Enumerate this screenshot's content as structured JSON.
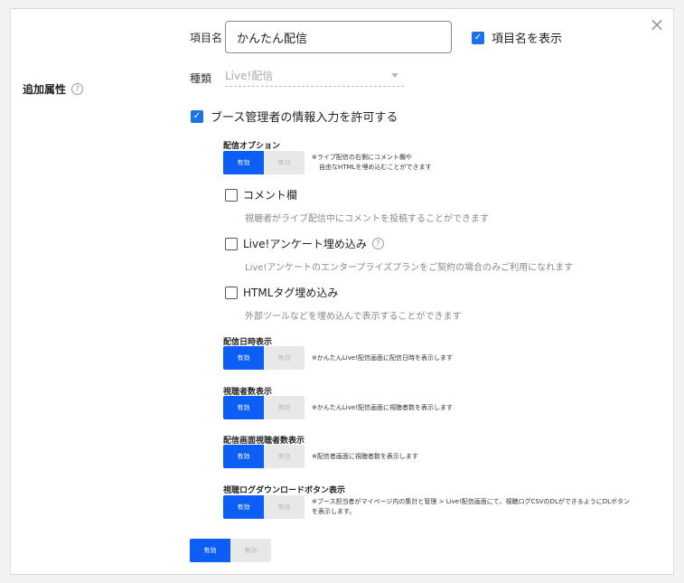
{
  "section": {
    "label": "追加属性",
    "help_icon": "question-circle-icon"
  },
  "item_name": {
    "label": "項目名",
    "value": "かんたん配信"
  },
  "show_item_name": {
    "label": "項目名を表示",
    "checked": true
  },
  "type": {
    "label": "種類",
    "value": "Live!配信"
  },
  "allow_booth": {
    "label": "ブース管理者の情報入力を許可する",
    "checked": true
  },
  "delivery_option": {
    "title": "配信オプション",
    "on_label": "有効",
    "off_label": "無効",
    "note_line1": "※ライブ配信の右側にコメント欄や",
    "note_line2": "自由なHTMLを埋め込むことができます"
  },
  "sub_options": [
    {
      "label": "コメント欄",
      "desc": "視聴者がライブ配信中にコメントを投稿することができます",
      "checked": false
    },
    {
      "label": "Live!アンケート埋め込み",
      "desc": "Live!アンケートのエンタープライズプランをご契約の場合のみご利用になれます",
      "checked": false
    },
    {
      "label": "HTMLタグ埋め込み",
      "desc": "外部ツールなどを埋め込んで表示することができます",
      "checked": false
    }
  ],
  "datetime_display": {
    "title": "配信日時表示",
    "on_label": "有効",
    "off_label": "無効",
    "note": "※かんたんLive!配信画面に配信日時を表示します"
  },
  "viewer_count": {
    "title": "視聴者数表示",
    "on_label": "有効",
    "off_label": "無効",
    "note": "※かんたんLive!配信画面に視聴者数を表示します"
  },
  "screen_viewer_count": {
    "title": "配信画面視聴者数表示",
    "on_label": "有効",
    "off_label": "無効",
    "note": "※配信者画面に視聴者数を表示します"
  },
  "log_download": {
    "title": "視聴ログダウンロードボタン表示",
    "on_label": "有効",
    "off_label": "無効",
    "note_line1": "※ブース担当者がマイページ内の集計と管理 > Live!配信画面にて、視聴ログCSVのDLができるようにDLボタン",
    "note_line2": "を表示します。"
  },
  "bottom_toggle": {
    "on_label": "有効",
    "off_label": "無効"
  },
  "colors": {
    "accent": "#0d5ef5",
    "checkbox": "#1a73e8"
  }
}
